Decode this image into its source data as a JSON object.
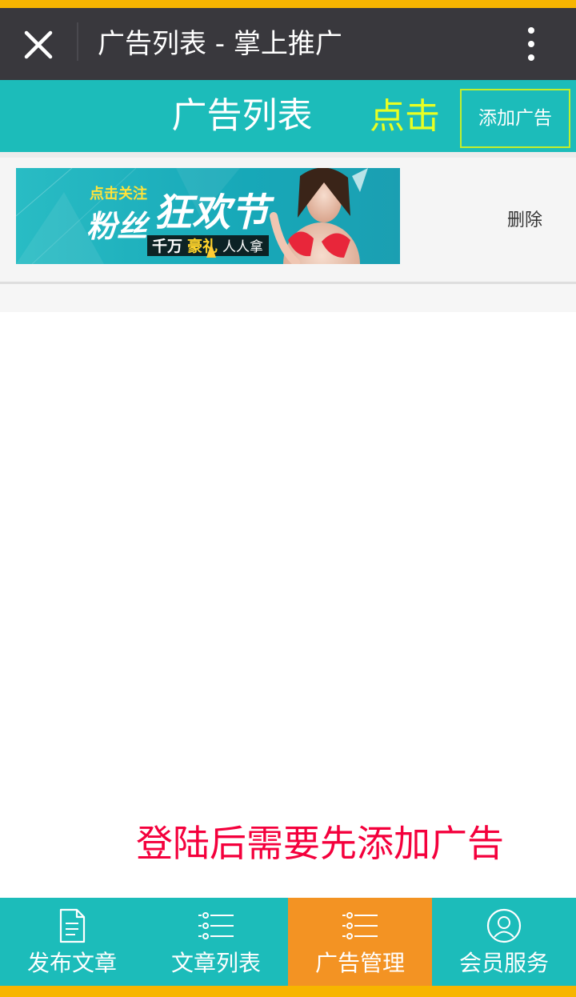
{
  "titlebar": {
    "title": "广告列表 - 掌上推广"
  },
  "page_header": {
    "title": "广告列表",
    "click_annotation": "点击",
    "add_button_label": "添加广告"
  },
  "ad_list": [
    {
      "banner": {
        "small_heading": "点击关注",
        "big_left": "粉丝",
        "big_main": "狂欢节",
        "strip_a": "千万",
        "strip_b": "豪礼",
        "strip_c": "人人拿"
      },
      "delete_label": "删除"
    }
  ],
  "annotation": {
    "login_hint": "登陆后需要先添加广告"
  },
  "tabbar": {
    "tabs": [
      {
        "label": "发布文章",
        "icon": "document-icon"
      },
      {
        "label": "文章列表",
        "icon": "list-icon"
      },
      {
        "label": "广告管理",
        "icon": "list-icon",
        "active": true
      },
      {
        "label": "会员服务",
        "icon": "user-icon"
      }
    ]
  },
  "colors": {
    "teal": "#1cbcba",
    "orange_active": "#f39323",
    "titlebar": "#39383d",
    "accent_yellow": "#f7b500",
    "annotation_yellow": "#e8ff22",
    "annotation_red": "#f4003c"
  }
}
